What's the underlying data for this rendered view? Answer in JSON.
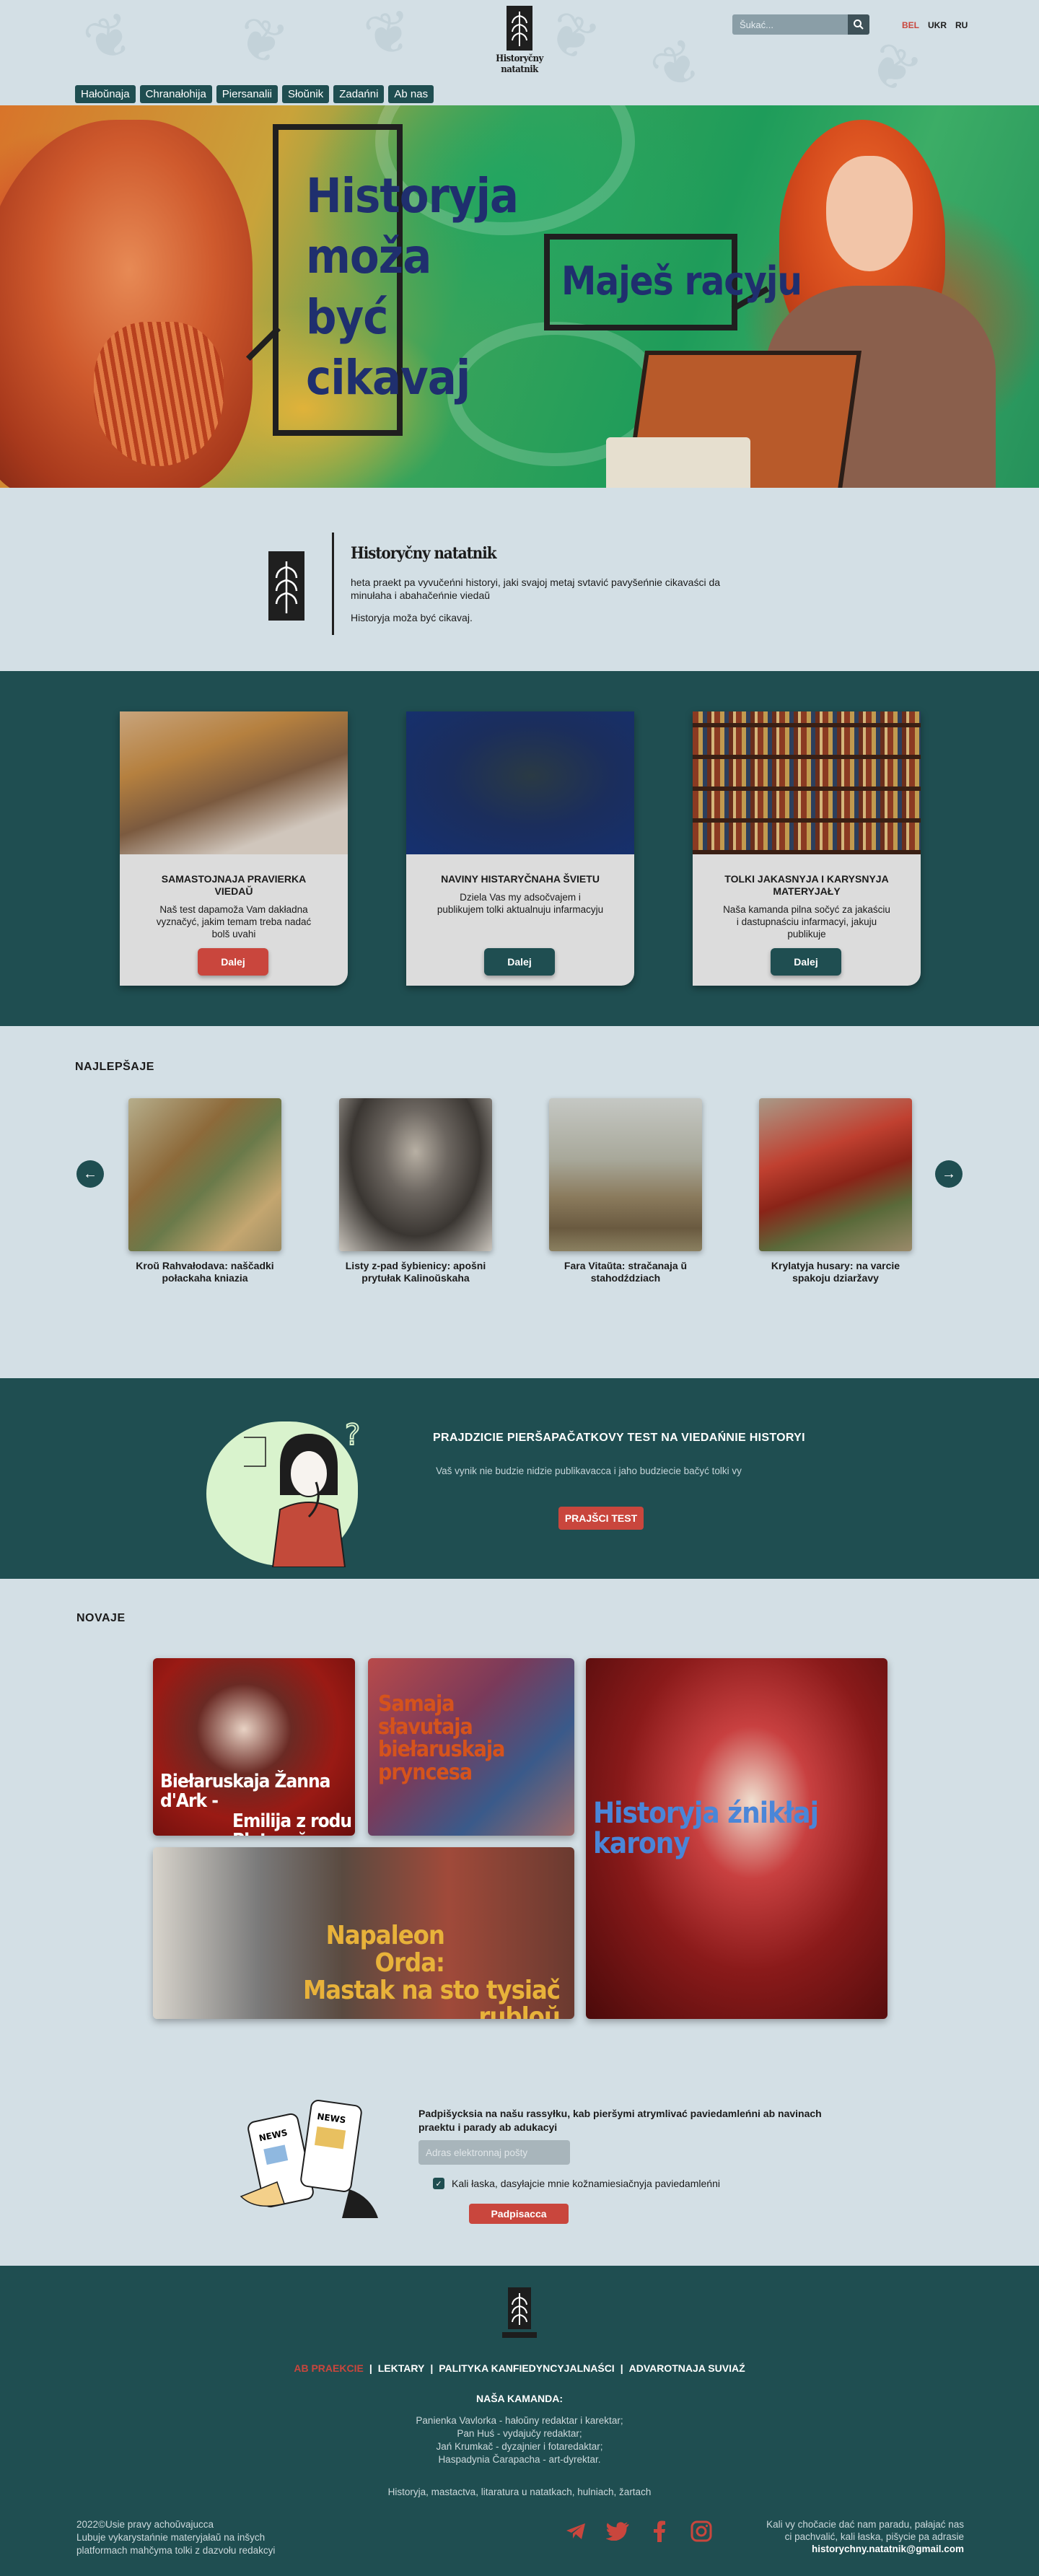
{
  "header": {
    "logo_text": "Historyčny natatnik",
    "search_placeholder": "Šukać...",
    "languages": [
      "BEL",
      "UKR",
      "RU"
    ],
    "active_language": "BEL",
    "nav": [
      "Hałoŭnaja",
      "Chranałohija",
      "Piersanalii",
      "Słoŭnik",
      "Zadańni",
      "Ab nas"
    ]
  },
  "hero": {
    "bubble1_lines": [
      "Historyja",
      "moža",
      "być",
      "cikavaj"
    ],
    "bubble2": "Maješ racyju"
  },
  "about": {
    "title": "Historyčny natatnik",
    "description": "heta praekt pa vyvučeńni historyi, jaki svajoj metaj svtavić pavyšeńnie cikavaści da minułaha i abahačeńnie viedaŭ",
    "slogan": "Historyja moža być cikavaj."
  },
  "services": [
    {
      "title": "SAMASTOJNAJA PRAVIERKA VIEDAŬ",
      "text": "Naš test dapamoža Vam dakładna vyznačyć, jakim temam treba nadać bolš uvahi",
      "button": "Dalej",
      "color": "#c9463d"
    },
    {
      "title": "NAVINY HISTARYČNAHA ŠVIETU",
      "text": "Dziela Vas my adsočvajem i publikujem tolki aktualnuju infarmacyju",
      "button": "Dalej",
      "color": "#1f4e51"
    },
    {
      "title": "TOLKI JAKASNYJA I KARYSNYJA MATERYJAŁY",
      "text": "Naša kamanda pilna sočyć za jakaściu i dastupnaściu infarmacyi, jakuju publikuje",
      "button": "Dalej",
      "color": "#1f4e51"
    }
  ],
  "best": {
    "title": "NAJLEPŠAJE",
    "items": [
      {
        "caption": "Kroŭ Rahvałodava: naščadki połackaha kniazia"
      },
      {
        "caption": "Listy z-pad šybienicy: apošni prytułak Kalinoŭskaha"
      },
      {
        "caption": "Fara Vitaŭta: stračanaja ŭ stahodździach"
      },
      {
        "caption": "Krylatyja husary: na varcie spakoju dziaržavy"
      }
    ],
    "prev_icon": "arrow-left-icon",
    "next_icon": "arrow-right-icon"
  },
  "test": {
    "title": "PRAJDZICIE PIERŠAPAČATKOVY TEST NA VIEDAŃNIE HISTORYI",
    "description": "Vaš vynik nie budzie nidzie publikavacca i jaho budziecie bačyć tolki vy",
    "button": "PRAJŠCI TEST"
  },
  "news": {
    "title": "NOVAJE",
    "tiles": [
      {
        "line1": "Biełaruskaja Žanna d'Ark -",
        "line2": "Emilija z rodu Plateraŭ"
      },
      {
        "line1": "Samaja",
        "line2": "słavutaja",
        "line3": "biełaruskaja",
        "line4": "pryncesa"
      },
      {
        "line1": "Historyja źnikłaj karony"
      },
      {
        "line1": "Napaleon Orda:",
        "line2": "Mastak na sto tysiač rubloŭ"
      }
    ]
  },
  "subscribe": {
    "title": "Padpišycksia na našu rassyłku, kab pieršymi atrymlivać paviedamleńni ab navinach praektu i parady ab adukacyi",
    "placeholder": "Adras elektronnaj pošty",
    "checkbox_label": "Kali łaska, dasyłajcie mnie kožnamiesiačnyja paviedamleńni",
    "button": "Padpisacca"
  },
  "footer": {
    "links": [
      "AB PRAEKCIE",
      "LEKTARY",
      "PALITYKA KANFIEDYNCYJALNAŚCI",
      "ADVAROTNAJA SUVIAŹ"
    ],
    "team_title": "NAŠA KAMANDA:",
    "team": [
      "Panienka Vavlorka - hałoŭny redaktar i karektar;",
      "Pan Huś - vydajučy redaktar;",
      "Jań Krumkač - dyzajnier i fotaredaktar;",
      "Haspadynia Čarapacha - art-dyrektar."
    ],
    "topics": "Historyja, mastactva, litaratura u natatkach, hulniach, žartach",
    "copyright_lines": [
      "2022©Usie pravy achoŭvajucca",
      "Lubuje vykarystańnie materyjałaŭ na inšych",
      "platformach mahčyma tolki z dazvołu redakcyi"
    ],
    "contact_lines": [
      "Kali vy chočacie dać nam paradu, pałajać nas",
      "ci pachvalić, kali łaska, pišycie pa adrasie"
    ],
    "email": "historychny.natatnik@gmail.com",
    "social_icons": [
      "telegram-icon",
      "twitter-icon",
      "facebook-icon",
      "instagram-icon"
    ]
  }
}
